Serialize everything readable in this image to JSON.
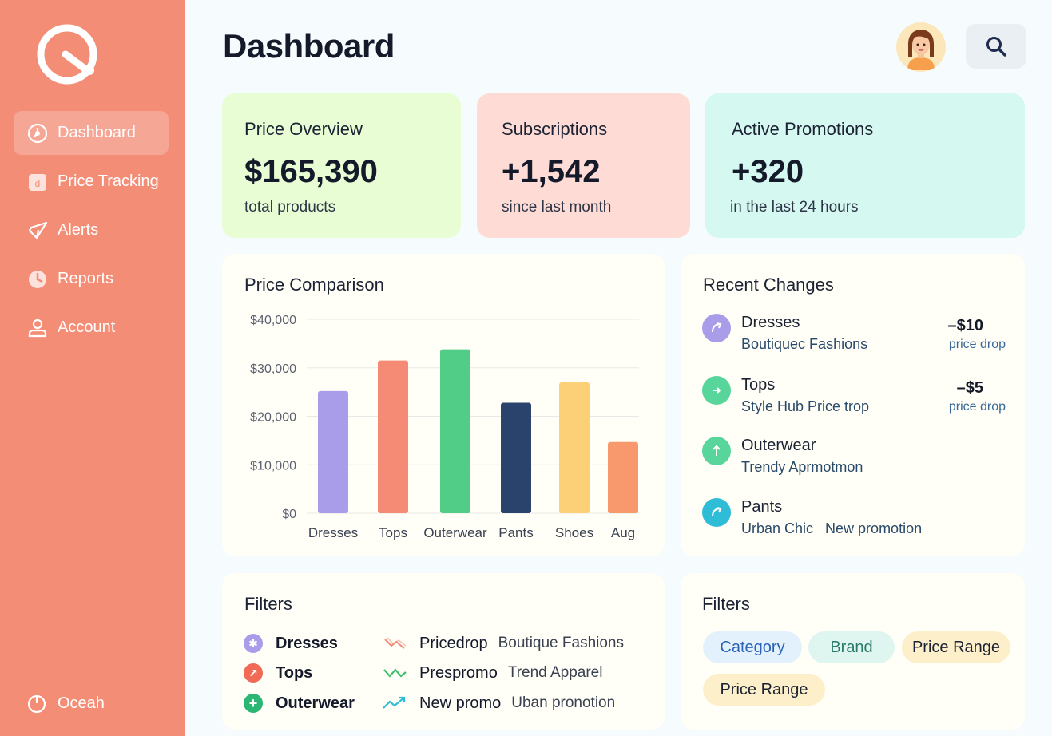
{
  "sidebar": {
    "logo": "app-logo",
    "items": [
      {
        "label": "Dashboard",
        "icon": "dashboard-icon",
        "active": true
      },
      {
        "label": "Price Tracking",
        "icon": "price-tag-icon"
      },
      {
        "label": "Alerts",
        "icon": "alert-icon"
      },
      {
        "label": "Reports",
        "icon": "reports-icon"
      },
      {
        "label": "Account",
        "icon": "user-icon"
      }
    ],
    "footer": {
      "label": "Oceah",
      "icon": "power-icon"
    }
  },
  "header": {
    "title": "Dashboard",
    "avatar": "user-avatar",
    "search_icon": "search-icon"
  },
  "stats": [
    {
      "title": "Price Overview",
      "value": "$165,390",
      "sub": "total products",
      "color": "#e8fdd4"
    },
    {
      "title": "Subscriptions",
      "value": "+1,542",
      "sub": "since last month",
      "color": "#fedcd5"
    },
    {
      "title": "Active Promotions",
      "value": "+320",
      "sub": "in the last 24 hours",
      "color": "#d5f8f1"
    }
  ],
  "comparison": {
    "title": "Price Comparison"
  },
  "chart_data": {
    "type": "bar",
    "categories": [
      "Dresses",
      "Tops",
      "Outerwear",
      "Pants",
      "Shoes",
      "Aug"
    ],
    "values": [
      25200,
      31500,
      33800,
      22800,
      27000,
      14700
    ],
    "colors": [
      "#a99de9",
      "#f58a75",
      "#52cd87",
      "#29436c",
      "#fbd077",
      "#f7996d"
    ],
    "ylim": [
      0,
      40000
    ],
    "yticks": [
      0,
      10000,
      20000,
      30000,
      40000
    ],
    "ytick_labels": [
      "$0",
      "$10,000",
      "$20,000",
      "$30,000",
      "$40,000"
    ],
    "grid": true,
    "title": "Price Comparison",
    "xlabel": "",
    "ylabel": ""
  },
  "recent_changes": {
    "title": "Recent Changes",
    "items": [
      {
        "name": "Dresses",
        "store": "Boutiquec Fashions",
        "amount": "–$10",
        "note": "price drop",
        "color": "#a99de9",
        "icon": "arrow-up-right-icon"
      },
      {
        "name": "Tops",
        "store": "Style Hub Price trop",
        "amount": "–$5",
        "note": "price drop",
        "color": "#57d59a",
        "icon": "arrow-right-icon"
      },
      {
        "name": "Outerwear",
        "store": "Trendy Aprmotmon",
        "amount": "",
        "note": "",
        "color": "#57d59a",
        "icon": "arrow-up-icon"
      },
      {
        "name": "Pants",
        "store": "Urban Chic   New promotion",
        "amount": "",
        "note": "",
        "color": "#2fbcd6",
        "icon": "arrow-up-right-icon"
      }
    ]
  },
  "filters": {
    "title": "Filters",
    "categories": [
      {
        "label": "Dresses",
        "color": "#a99de9",
        "icon": "sparkle-icon"
      },
      {
        "label": "Tops",
        "color": "#f06a55",
        "icon": "arrow-up-right-icon"
      },
      {
        "label": "Outerwear",
        "color": "#2bb673",
        "icon": "plus-icon"
      }
    ],
    "promotions": [
      {
        "type": "Pricedrop",
        "store": "Boutique Fashions",
        "color": "#f58a75",
        "icon": "trend-down-icon"
      },
      {
        "type": "Prespromo",
        "store": "Trend Apparel",
        "color": "#3bbf6b",
        "icon": "trend-wave-icon"
      },
      {
        "type": "New promo",
        "store": "Uban pronotion",
        "color": "#2fbcd6",
        "icon": "trend-up-icon"
      }
    ]
  },
  "filters2": {
    "title": "Filters",
    "chips": [
      {
        "label": "Category",
        "bg": "#e3f1fd",
        "fg": "#2a63b6"
      },
      {
        "label": "Brand",
        "bg": "#dff5ef",
        "fg": "#2a7a6b"
      },
      {
        "label": "Price Range",
        "bg": "#fdefc9",
        "fg": "#1b2233"
      },
      {
        "label": "Price Range",
        "bg": "#fdefc9",
        "fg": "#1b2233"
      }
    ]
  }
}
